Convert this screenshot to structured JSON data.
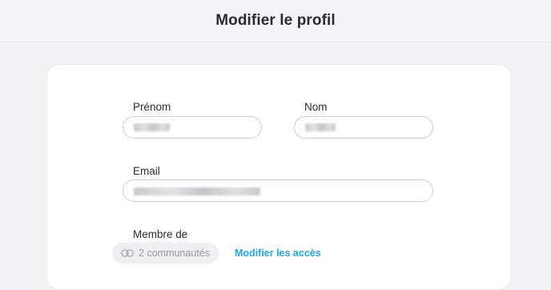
{
  "header": {
    "title": "Modifier le profil"
  },
  "form": {
    "first_name": {
      "label": "Prénom",
      "value": ""
    },
    "last_name": {
      "label": "Nom",
      "value": ""
    },
    "email": {
      "label": "Email",
      "value": ""
    },
    "membership": {
      "label": "Membre de",
      "communities_badge": "2 communautés",
      "edit_access_link": "Modifier les accès"
    }
  },
  "icons": {
    "communities": "two-overlapping-circles-icon"
  },
  "colors": {
    "accent": "#1aa7ec",
    "text": "#2b2b33",
    "background": "#f2f2f4"
  }
}
